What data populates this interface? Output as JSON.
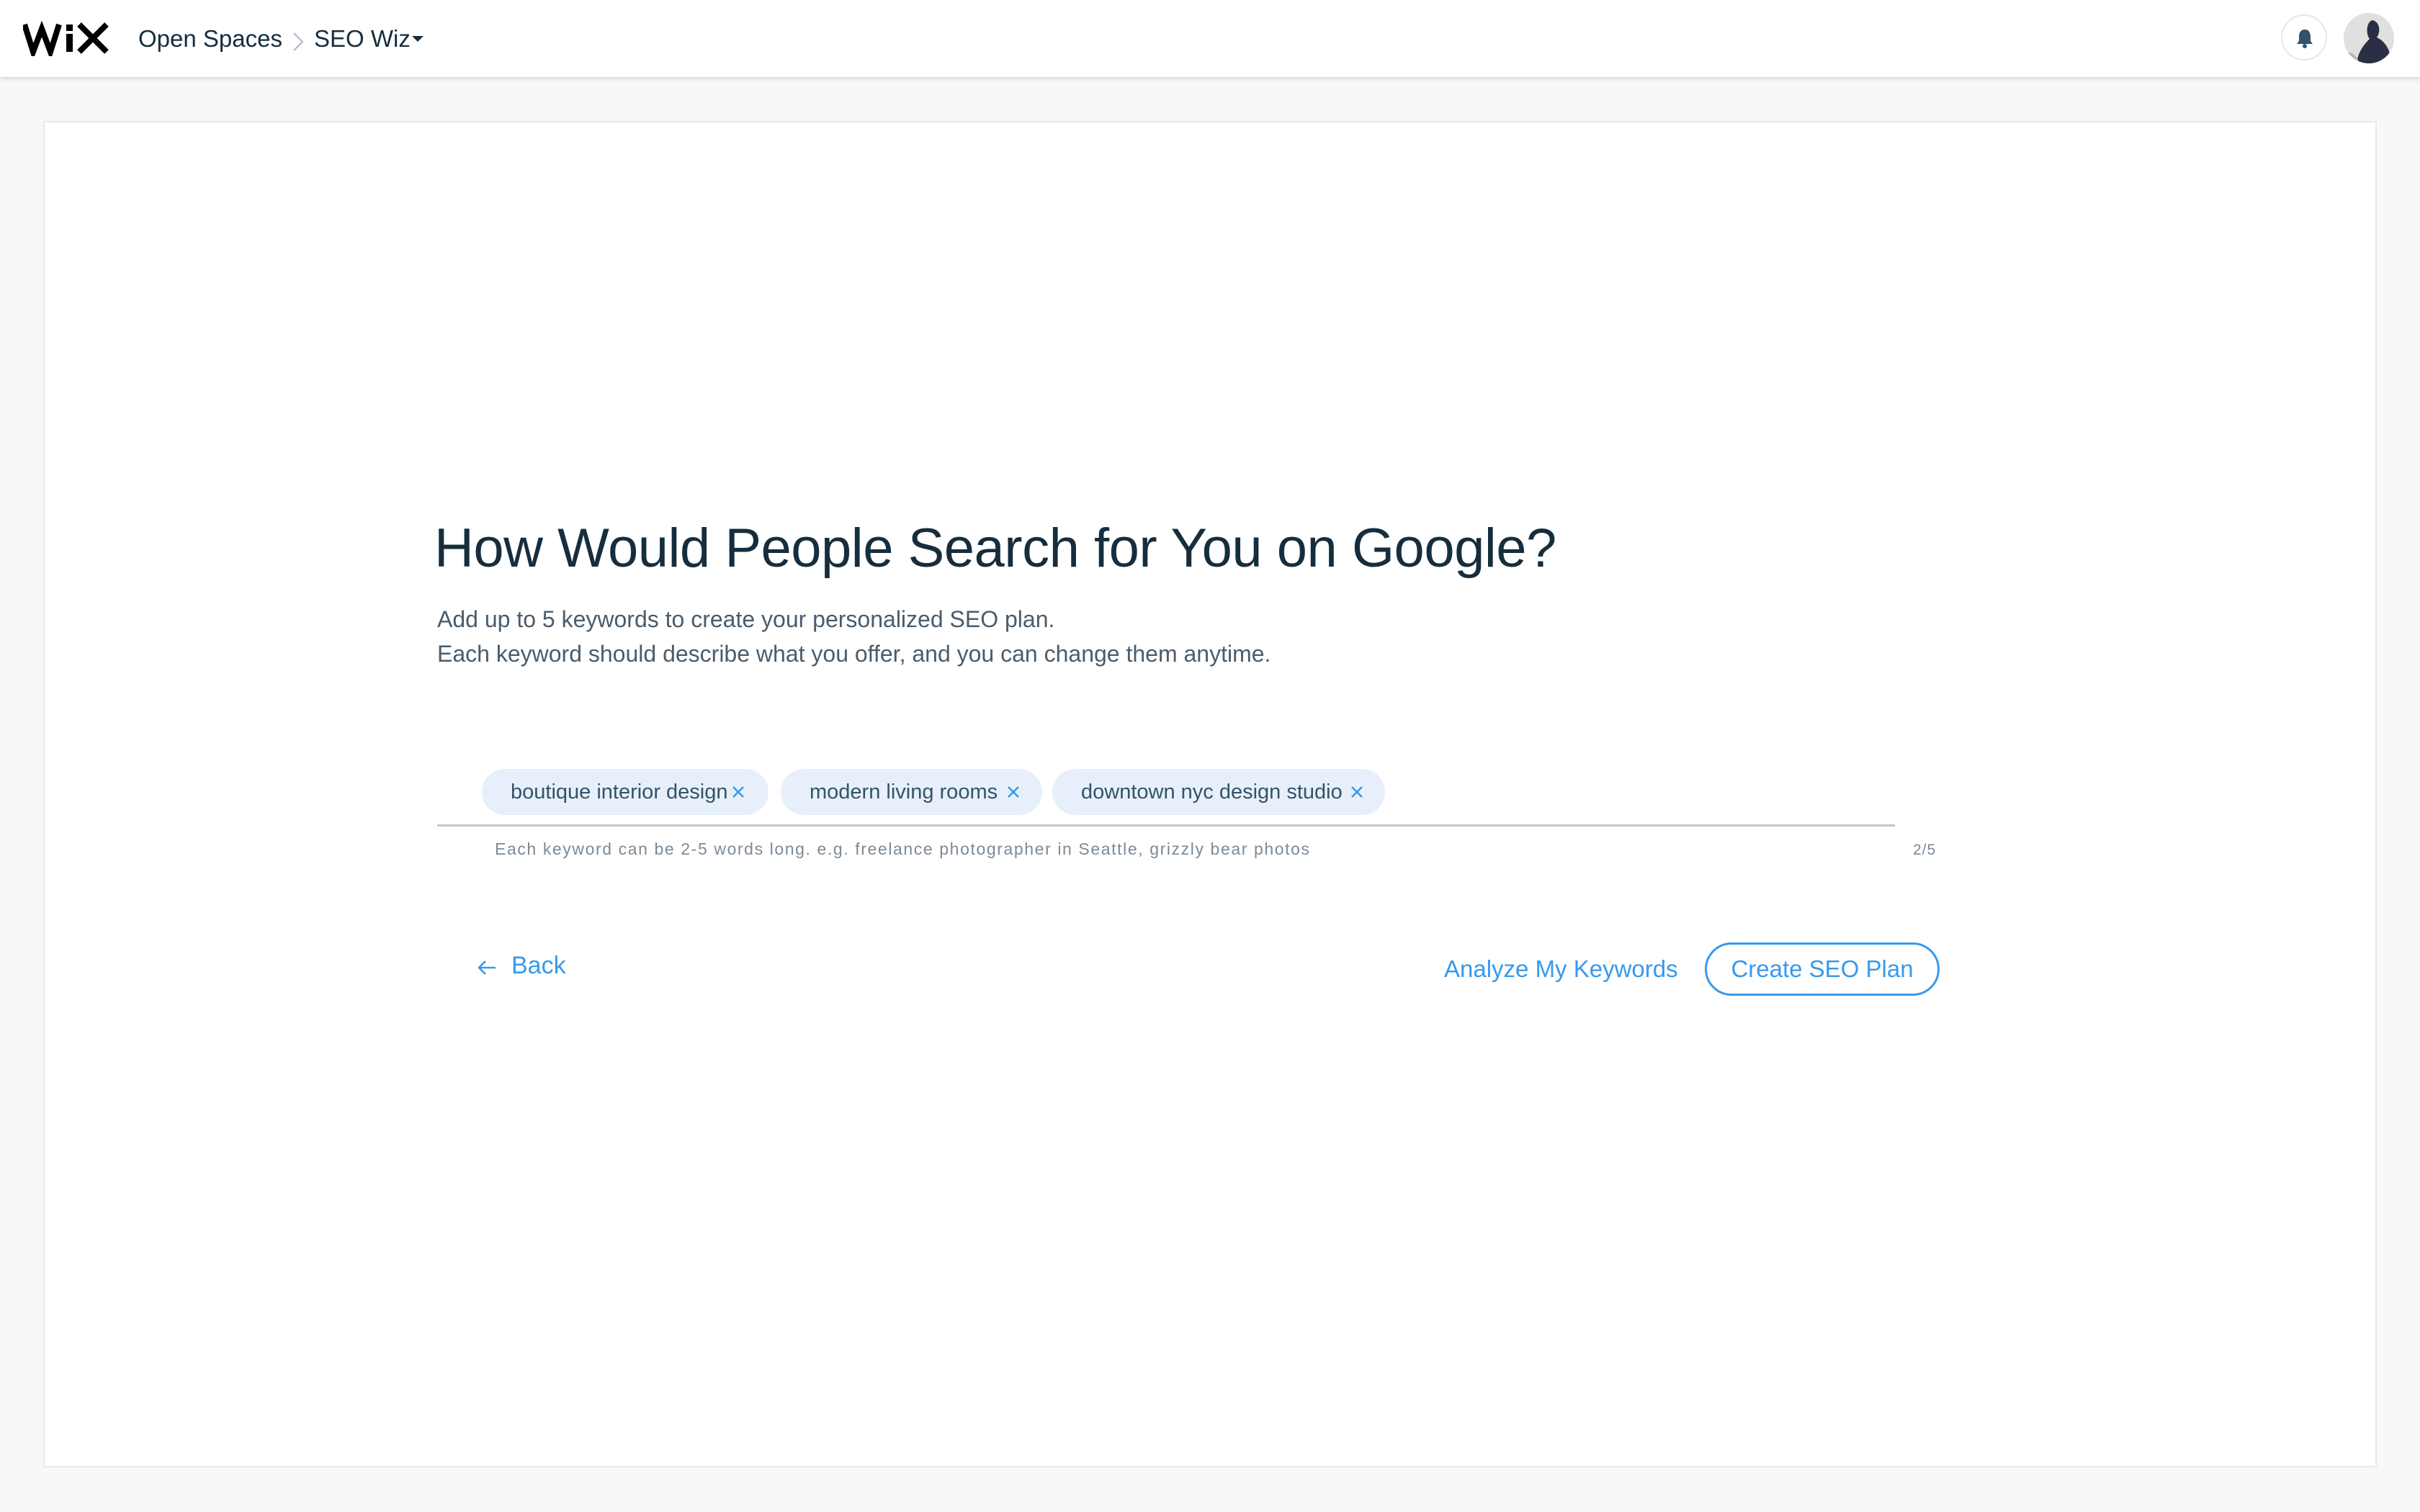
{
  "header": {
    "logo_text": "WiX",
    "breadcrumb": {
      "site_name": "Open Spaces",
      "app_name": "SEO Wiz"
    },
    "icons": [
      "wix-logo",
      "chevron-right-icon",
      "caret-down-icon",
      "bell-icon",
      "avatar"
    ]
  },
  "main": {
    "title": "How Would People Search for You on Google?",
    "subtitle_line1": "Add up to 5 keywords to create your personalized SEO plan.",
    "subtitle_line2": "Each keyword should describe what you offer, and you can change them anytime.",
    "keywords": [
      {
        "label": "boutique interior design"
      },
      {
        "label": "modern living rooms"
      },
      {
        "label": "downtown nyc design studio"
      }
    ],
    "hint": "Each keyword can be 2-5 words long. e.g. freelance photographer in Seattle, grizzly bear photos",
    "counter": "2/5"
  },
  "actions": {
    "back_label": "Back",
    "analyze_label": "Analyze My Keywords",
    "create_label": "Create SEO Plan"
  },
  "colors": {
    "accent": "#3899ec",
    "tag_background": "#e7f0fa",
    "title_text": "#162d3d",
    "page_background": "#f7f8f8"
  }
}
